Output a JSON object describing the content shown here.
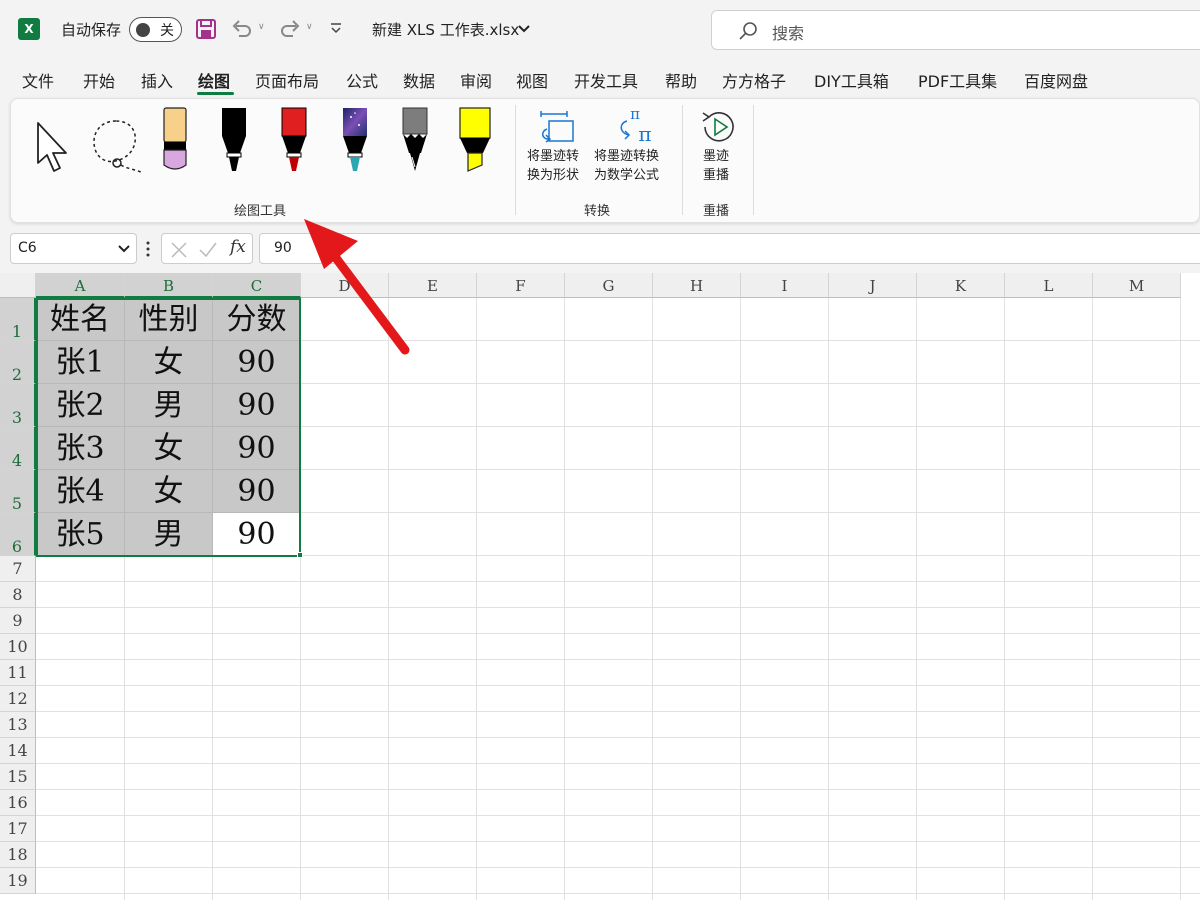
{
  "titlebar": {
    "app_icon": "X",
    "autosave_label": "自动保存",
    "autosave_state": "关",
    "file_name": "新建 XLS 工作表.xlsx",
    "search_placeholder": "搜索"
  },
  "tabs": [
    {
      "label": "文件"
    },
    {
      "label": "开始"
    },
    {
      "label": "插入"
    },
    {
      "label": "绘图",
      "active": true
    },
    {
      "label": "页面布局"
    },
    {
      "label": "公式"
    },
    {
      "label": "数据"
    },
    {
      "label": "审阅"
    },
    {
      "label": "视图"
    },
    {
      "label": "开发工具"
    },
    {
      "label": "帮助"
    },
    {
      "label": "方方格子"
    },
    {
      "label": "DIY工具箱"
    },
    {
      "label": "PDF工具集"
    },
    {
      "label": "百度网盘"
    }
  ],
  "ribbon": {
    "groups": [
      {
        "label": "绘图工具"
      },
      {
        "label": "转换"
      },
      {
        "label": "重播"
      }
    ],
    "ink_to_shape_line1": "将墨迹转",
    "ink_to_shape_line2": "换为形状",
    "ink_to_math_line1": "将墨迹转换",
    "ink_to_math_line2": "为数学公式",
    "replay_line1": "墨迹",
    "replay_line2": "重播",
    "pens": [
      {
        "name": "pen-beige",
        "color": "#f7d08a",
        "tip": "#d9a7e0"
      },
      {
        "name": "pen-black",
        "color": "#000000",
        "tip": "#000000"
      },
      {
        "name": "pen-red",
        "color": "#e02020",
        "tip": "#c00000"
      },
      {
        "name": "pen-galaxy",
        "color": "#3b3a8f",
        "tip": "#2aa7b0"
      },
      {
        "name": "pen-gray",
        "color": "#7d7d7d",
        "tip": "#000000"
      },
      {
        "name": "highlighter-yellow",
        "color": "#ffff00",
        "tip": "#ffff00"
      }
    ]
  },
  "formula_bar": {
    "name_box": "C6",
    "fx_label": "fx",
    "value": "90"
  },
  "sheet": {
    "columns": [
      "A",
      "B",
      "C",
      "D",
      "E",
      "F",
      "G",
      "H",
      "I",
      "J",
      "K",
      "L",
      "M"
    ],
    "rows": [
      "1",
      "2",
      "3",
      "4",
      "5",
      "6",
      "7",
      "8",
      "9",
      "10",
      "11",
      "12",
      "13",
      "14",
      "15",
      "16",
      "17",
      "18",
      "19"
    ],
    "data": [
      [
        "姓名",
        "性别",
        "分数"
      ],
      [
        "张1",
        "女",
        "90"
      ],
      [
        "张2",
        "男",
        "90"
      ],
      [
        "张3",
        "女",
        "90"
      ],
      [
        "张4",
        "女",
        "90"
      ],
      [
        "张5",
        "男",
        "90"
      ]
    ]
  },
  "colors": {
    "accent": "#107c41",
    "selection_fill": "#c8c8c8",
    "arrow": "#e3181b"
  }
}
